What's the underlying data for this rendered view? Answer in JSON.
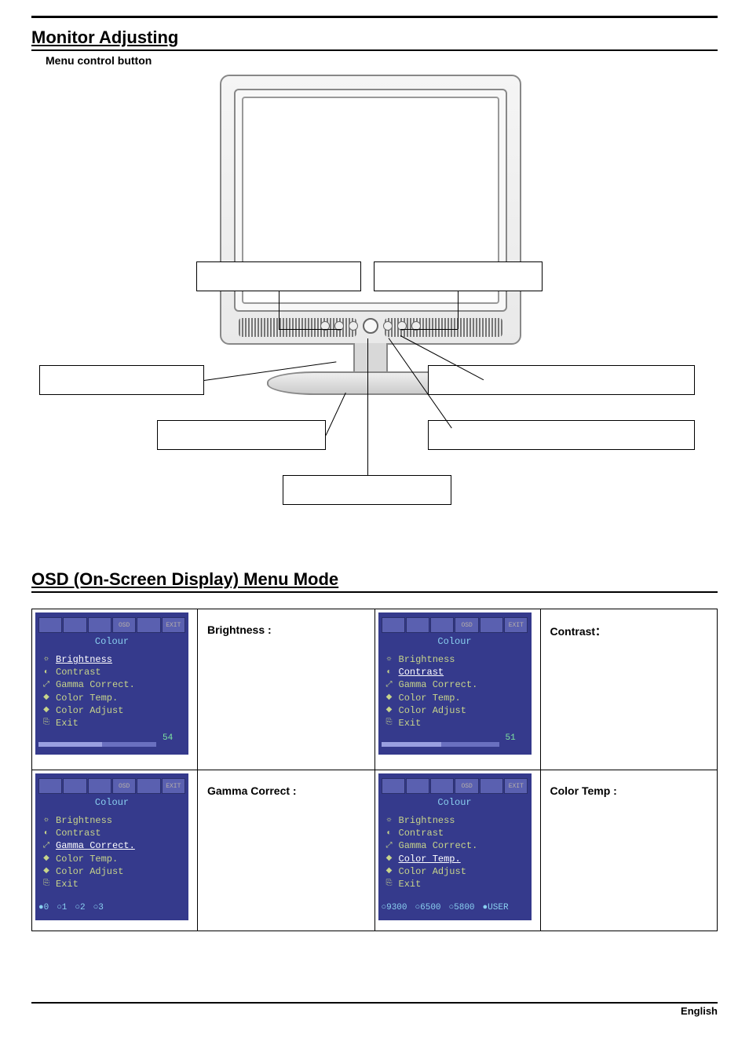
{
  "page": {
    "heading1": "Monitor Adjusting",
    "sub_heading": "Menu control button",
    "heading2": "OSD (On-Screen Display) Menu Mode",
    "footer_lang": "English"
  },
  "osd_common": {
    "title": "Colour",
    "items": [
      "Brightness",
      "Contrast",
      "Gamma Correct.",
      "Color Temp.",
      "Color Adjust",
      "Exit"
    ],
    "icon_labels": [
      "",
      "",
      "",
      "OSD",
      "",
      "EXIT"
    ]
  },
  "osd_cells": [
    {
      "label": "Brightness :",
      "label_type": "en",
      "selected_index": 0,
      "footer_type": "bar",
      "bar_value": "54"
    },
    {
      "label": "Contrast：",
      "label_type": "cjk_colon",
      "selected_index": 1,
      "footer_type": "bar",
      "bar_value": "51"
    },
    {
      "label": "Gamma Correct :",
      "label_type": "en",
      "selected_index": 2,
      "footer_type": "options",
      "options": [
        "●0",
        "○1",
        "○2",
        "○3"
      ]
    },
    {
      "label": "Color Temp :",
      "label_type": "en",
      "selected_index": 3,
      "footer_type": "options",
      "options": [
        "○9300",
        "○6500",
        "○5800",
        "●USER"
      ]
    }
  ]
}
